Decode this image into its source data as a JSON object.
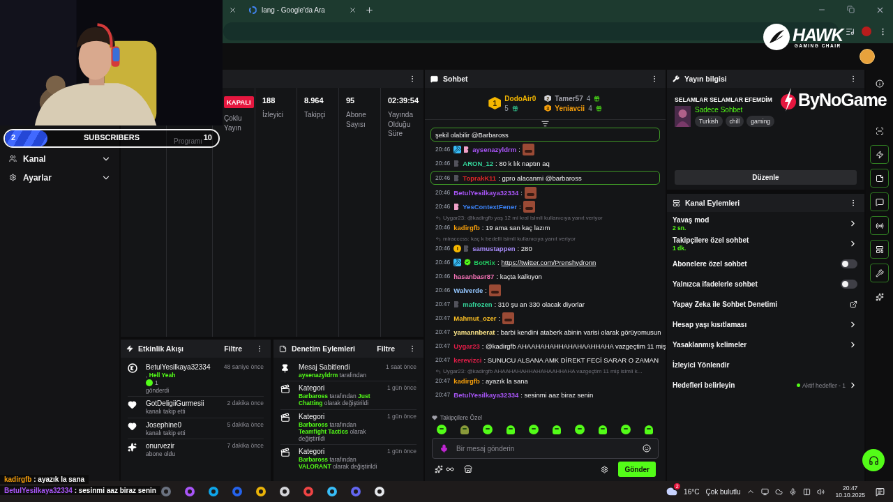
{
  "browser": {
    "tabs": [
      {
        "selected": false
      },
      {
        "label": "lang - Google'da Ara",
        "selected": false
      }
    ]
  },
  "sub_goal": {
    "current": "2",
    "label": "SUBSCRIBERS",
    "target": "10",
    "level": 0.2
  },
  "sponsors": [
    {
      "name": "HAWK",
      "tagline": "GAMING CHAIR"
    },
    {
      "name": "ByNoGame"
    }
  ],
  "sidebar": {
    "items": [
      {
        "label": "Kanal",
        "expanded": false
      },
      {
        "label": "Ayarlar",
        "expanded": false
      }
    ]
  },
  "stats": {
    "columns": [
      {
        "label": "Programı"
      },
      {
        "badge": "KAPALI",
        "label": "Çoklu Yayın"
      },
      {
        "value": "188",
        "label": "İzleyici"
      },
      {
        "value": "8.964",
        "label": "Takipçi"
      },
      {
        "value": "95",
        "label": "Abone Sayısı"
      },
      {
        "value": "02:39:54",
        "label": "Yayında Olduğu Süre"
      }
    ]
  },
  "activity_feed": {
    "title": "Etkinlik Akışı",
    "filter": "Filtre",
    "events": [
      {
        "kind": "gift",
        "user": "BetulYesilkaya32334",
        "time": "48 saniye önce",
        "detail": [
          {
            "text": ",",
            "accent": false
          },
          {
            "text": "Hell Yeah",
            "accent": true
          }
        ],
        "amount": "1",
        "action": "gönderdi"
      },
      {
        "kind": "follow",
        "user": "GotDeligiiGurmesii",
        "time": "2 dakika önce",
        "action": "kanalı takip etti"
      },
      {
        "kind": "follow",
        "user": "Josephine0",
        "time": "5 dakika önce",
        "action": "kanalı takip etti"
      },
      {
        "kind": "sub",
        "user": "onurvezir",
        "time": "7 dakika önce",
        "action": "abone oldu"
      }
    ]
  },
  "moderation": {
    "title": "Denetim Eylemleri",
    "filter": "Filtre",
    "actions": [
      {
        "kind": "pin",
        "title": "Mesaj Sabitlendi",
        "time": "1 saat önce",
        "detail": [
          {
            "text": "aysenazyldrm",
            "accent": true
          },
          {
            "text": "tarafından",
            "accent": false
          }
        ]
      },
      {
        "kind": "category",
        "title": "Kategori",
        "time": "1 gün önce",
        "detail": [
          {
            "text": "Barbaross",
            "accent": true
          },
          {
            "text": "tarafından",
            "accent": false
          },
          {
            "text": "Just Chatting",
            "accent": true
          },
          {
            "text": "olarak değiştirildi",
            "accent": false
          }
        ]
      },
      {
        "kind": "category",
        "title": "Kategori",
        "time": "1 gün önce",
        "detail": [
          {
            "text": "Barbaross",
            "accent": true
          },
          {
            "text": "tarafından",
            "accent": false
          },
          {
            "text": "Teamfight Tactics",
            "accent": true
          },
          {
            "text": "olarak değiştirildi",
            "accent": false
          }
        ]
      },
      {
        "kind": "category",
        "title": "Kategori",
        "time": "1 gün önce",
        "detail": [
          {
            "text": "Barbaross",
            "accent": true
          },
          {
            "text": "tarafından",
            "accent": false
          },
          {
            "text": "VALORANT",
            "accent": true
          },
          {
            "text": "olarak değiştirildi",
            "accent": false
          }
        ]
      }
    ]
  },
  "chat": {
    "title": "Sohbet",
    "gifters": [
      {
        "rank": "1",
        "name": "DodoAir0",
        "count": "5"
      },
      {
        "rank": "2",
        "name": "Tamer57",
        "count": "4"
      },
      {
        "rank": "3",
        "name": "Yeniavcii",
        "count": "4"
      }
    ],
    "messages": [
      {
        "text": "şekil olabilir @Barbaross",
        "highlighted": true,
        "emote": false
      },
      {
        "time": "20:46",
        "badges": [
          {
            "kind": "mod"
          },
          {
            "kind": "sub"
          }
        ],
        "user": "aysenazyldrm",
        "color": "#a855f7",
        "text": ":",
        "emote": true,
        "highlighted": false
      },
      {
        "time": "20:46",
        "badges": [
          {
            "kind": "og"
          }
        ],
        "user": "ARON_12",
        "color": "#34d399",
        "text": ": 80 k lık naptın aq",
        "emote": false,
        "highlighted": false
      },
      {
        "time": "20:46",
        "badges": [
          {
            "kind": "og"
          }
        ],
        "user": "ToprakK11",
        "color": "#dc2626",
        "text": ": gpro alacanmi @barbaross",
        "emote": false,
        "highlighted": true
      },
      {
        "time": "20:46",
        "user": "BetulYesilkaya32334",
        "color": "#a855f7",
        "text": ":",
        "emote": true,
        "highlighted": false
      },
      {
        "time": "20:46",
        "badges": [
          {
            "kind": "sub"
          }
        ],
        "user": "YesContextFener",
        "color": "#3b82f6",
        "text": ":",
        "emote": true,
        "highlighted": false
      },
      {
        "reply": "Uygar23: @kadirgfb yaş 12 mi kral isimli kullanıcıya yanıt veriyor",
        "time": "20:46",
        "user": "kadirgfb",
        "color": "#f59e0b",
        "text": ": 19 ama san kaç lazım",
        "emote": false,
        "highlighted": false
      },
      {
        "reply": "miracccss: kaç k bedelli isimli kullanıcıya yanıt veriyor",
        "time": "20:46",
        "badges": [
          {
            "kind": "gifter"
          },
          {
            "kind": "og"
          }
        ],
        "user": "samustappen",
        "color": "#a78bfa",
        "text": ": 280",
        "emote": false,
        "highlighted": false
      },
      {
        "time": "20:46",
        "badges": [
          {
            "kind": "mod"
          },
          {
            "kind": "verified"
          }
        ],
        "user": "BotRix",
        "color": "#22c55e",
        "text": ":",
        "link": "https://twitter.com/Prenshydronn",
        "emote": false,
        "highlighted": false
      },
      {
        "time": "20:46",
        "user": "hasanbasr87",
        "color": "#f472b6",
        "text": ": kaçta kalkıyon",
        "emote": false,
        "highlighted": false
      },
      {
        "time": "20:46",
        "user": "Walverde",
        "color": "#93c5fd",
        "text": ":",
        "emote": true,
        "highlighted": false
      },
      {
        "time": "20:47",
        "badges": [
          {
            "kind": "og"
          }
        ],
        "user": "mafrozen",
        "color": "#34d399",
        "text": ": 310 şu an 330 olacak diyorlar",
        "emote": false,
        "highlighted": false
      },
      {
        "time": "20:47",
        "user": "Mahmut_ozer",
        "color": "#fbbf24",
        "text": ":",
        "emote": true,
        "highlighted": false
      },
      {
        "time": "20:47",
        "user": "yamannberat",
        "color": "#fde68a",
        "text": ": barbi kendini ataberk abinin varisi olarak görüyomusun",
        "emote": false,
        "highlighted": false
      },
      {
        "time": "20:47",
        "user": "Uygar23",
        "color": "#e11d48",
        "text": ": @kadirgfb AHAAHAHAHHAHAHAAHHAHA vazgeçtim 11 miş",
        "emote": false,
        "highlighted": false
      },
      {
        "time": "20:47",
        "user": "kerevizci",
        "color": "#e11d48",
        "text": ": SUNUCU ALSANA AMK DİREKT FECİ SARAR O ZAMAN",
        "emote": false,
        "highlighted": false
      },
      {
        "reply": "Uygar23: @kadirgfb AHAAHAHAHHAHAHAAHHAHA vazgeçtim 11 miş isimli k...",
        "time": "20:47",
        "user": "kadirgfb",
        "color": "#f59e0b",
        "text": ": ayazık la sana",
        "emote": false,
        "highlighted": false
      },
      {
        "time": "20:47",
        "user": "BetulYesilkaya32334",
        "color": "#a855f7",
        "text": ": sesinmi aaz biraz senin",
        "emote": false,
        "highlighted": false
      }
    ],
    "emote_section": "Takipçilere Özel",
    "placeholder": "Bir mesaj gönderin",
    "send": "Gönder"
  },
  "stream_info": {
    "title": "Yayın bilgisi",
    "stream_title": "SELAMLAR SELAMLAR EFEMDİM",
    "category": "Sadece Sohbet",
    "tags": [
      "Turkish",
      "chill",
      "gaming"
    ],
    "edit": "Düzenle"
  },
  "channel_actions": {
    "title": "Kanal Eylemleri",
    "items": [
      {
        "kind": "link",
        "label": "Yavaş mod",
        "value": "2 sn."
      },
      {
        "kind": "link",
        "label": "Takipçilere özel sohbet",
        "value": "1 dk."
      },
      {
        "kind": "toggle",
        "label": "Abonelere özel sohbet",
        "on": false
      },
      {
        "kind": "toggle",
        "label": "Yalnızca ifadelerle sohbet",
        "on": false
      },
      {
        "kind": "external",
        "label": "Yapay Zeka ile Sohbet Denetimi"
      },
      {
        "kind": "link",
        "label": "Hesap yaşı kısıtlaması"
      },
      {
        "kind": "link",
        "label": "Yasaklanmış kelimeler"
      },
      {
        "kind": "plain",
        "label": "İzleyici Yönlendir"
      },
      {
        "kind": "link",
        "label": "Hedefleri belirleyin",
        "status": "Aktif hedefler - 1"
      }
    ]
  },
  "rail": [
    {
      "selected": false
    },
    {
      "selected": false
    },
    {
      "selected": true
    },
    {
      "selected": true
    },
    {
      "selected": true
    },
    {
      "selected": true
    },
    {
      "selected": true
    },
    {
      "selected": true
    },
    {
      "selected": false
    }
  ],
  "overlay_chat": [
    {
      "user": "kadirgfb",
      "color": "#f59e0b",
      "text": ": ayazık la sana"
    },
    {
      "user": "BetulYesilkaya32334",
      "color": "#a855f7",
      "text": ": sesinmi aaz biraz senin"
    }
  ],
  "taskbar": {
    "weather": {
      "temp": "16°C",
      "condition": "Çok bulutlu",
      "alerts": "2"
    },
    "time": "20:47",
    "date": "10.10.2025"
  }
}
